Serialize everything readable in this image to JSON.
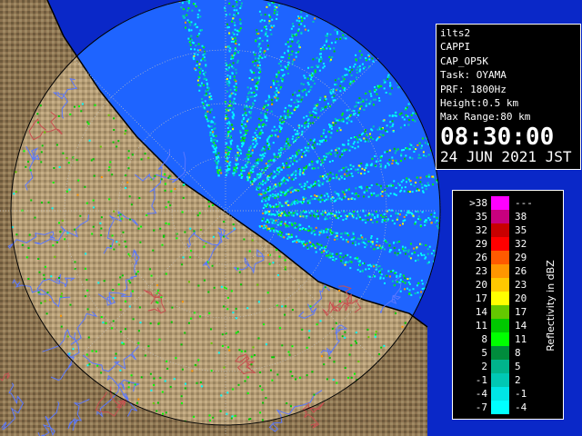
{
  "info": {
    "lines": [
      "ilts2",
      "CAPPI",
      "CAP_OP5K",
      "Task: OYAMA",
      "PRF: 1800Hz",
      "Height:0.5 km",
      "Max Range:80 km"
    ],
    "time": "08:30:00",
    "date": "24 JUN 2021 JST"
  },
  "legend": {
    "title": "Reflectivity in dBZ",
    "rows": [
      {
        "lo": ">38",
        "hi": "---",
        "color": "#ff00ff"
      },
      {
        "lo": "35",
        "hi": "38",
        "color": "#c8007e"
      },
      {
        "lo": "32",
        "hi": "35",
        "color": "#c80000"
      },
      {
        "lo": "29",
        "hi": "32",
        "color": "#ff0000"
      },
      {
        "lo": "26",
        "hi": "29",
        "color": "#ff5a00"
      },
      {
        "lo": "23",
        "hi": "26",
        "color": "#ff9600"
      },
      {
        "lo": "20",
        "hi": "23",
        "color": "#ffc800"
      },
      {
        "lo": "17",
        "hi": "20",
        "color": "#ffff00"
      },
      {
        "lo": "14",
        "hi": "17",
        "color": "#64c800"
      },
      {
        "lo": "11",
        "hi": "14",
        "color": "#00c800"
      },
      {
        "lo": "8",
        "hi": "11",
        "color": "#00ff00"
      },
      {
        "lo": "5",
        "hi": "8",
        "color": "#008c3c"
      },
      {
        "lo": "2",
        "hi": "5",
        "color": "#00b48c"
      },
      {
        "lo": "-1",
        "hi": "2",
        "color": "#00c8b4"
      },
      {
        "lo": "-4",
        "hi": "-1",
        "color": "#00e6e6"
      },
      {
        "lo": "-7",
        "hi": "-4",
        "color": "#00ffff"
      }
    ]
  },
  "map": {
    "sea_color": "#0a28c8",
    "sea_light": "#1e64ff",
    "land_color": "#8c7350",
    "river_color": "#5a78ff",
    "border_color": "#c85050",
    "range_ring_color": "#c0c0c0"
  }
}
